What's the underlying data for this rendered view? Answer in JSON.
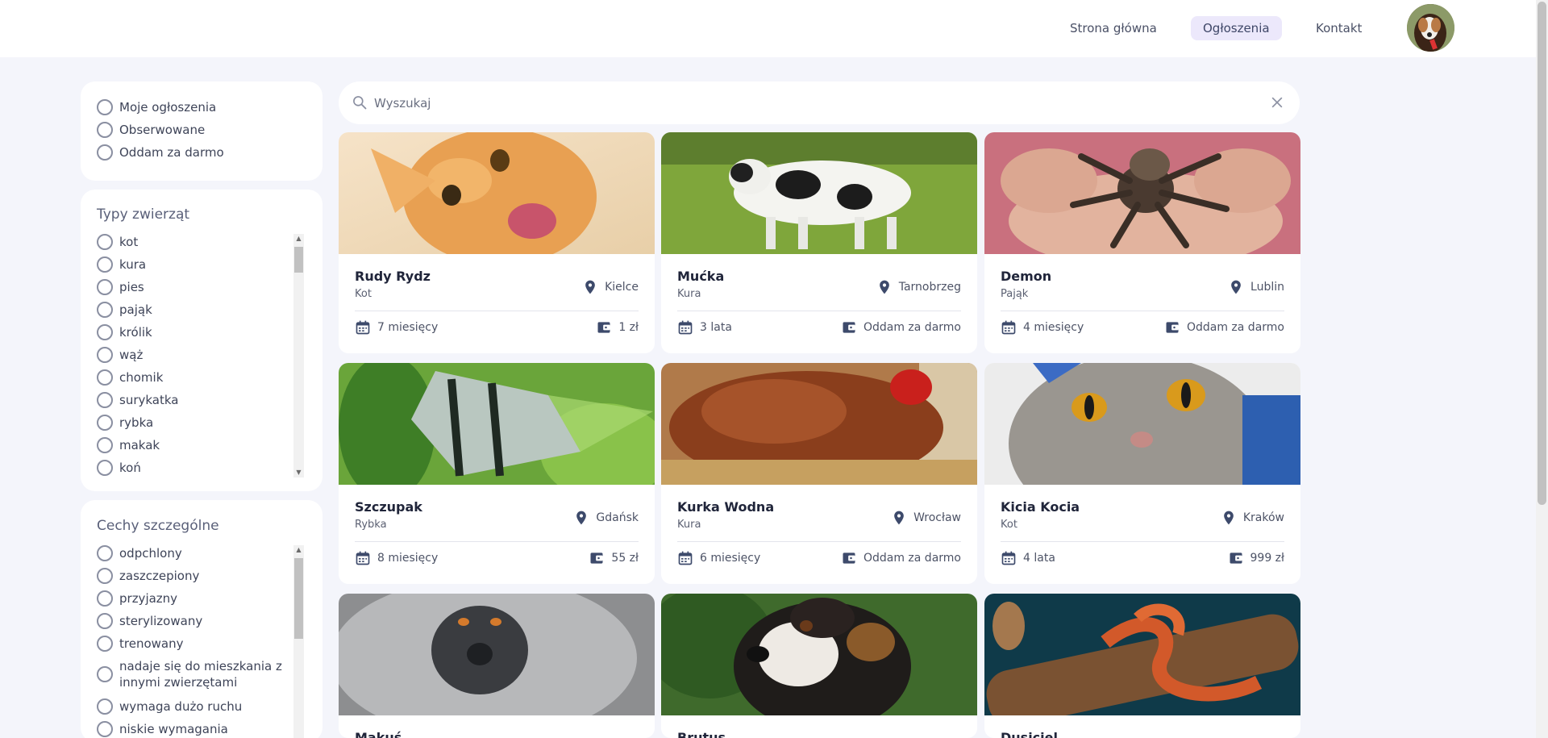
{
  "nav": {
    "links": [
      "Strona główna",
      "Ogłoszenia",
      "Kontakt"
    ],
    "active": "Ogłoszenia"
  },
  "quick_filters": [
    "Moje ogłoszenia",
    "Obserwowane",
    "Oddam za darmo"
  ],
  "animal_types": {
    "title": "Typy zwierząt",
    "items": [
      "kot",
      "kura",
      "pies",
      "pająk",
      "królik",
      "wąż",
      "chomik",
      "surykatka",
      "rybka",
      "makak",
      "koń"
    ]
  },
  "traits": {
    "title": "Cechy szczególne",
    "items": [
      "odpchlony",
      "zaszczepiony",
      "przyjazny",
      "sterylizowany",
      "trenowany",
      "nadaje się do mieszkania z innymi zwierzętami",
      "wymaga dużo ruchu",
      "niskie wymagania"
    ]
  },
  "search": {
    "placeholder": "Wyszukaj",
    "value": ""
  },
  "listings": [
    {
      "name": "Rudy Rydz",
      "type": "Kot",
      "location": "Kielce",
      "age": "7 miesięcy",
      "price": "1 zł",
      "photo": "orange-cat"
    },
    {
      "name": "Mućka",
      "type": "Kura",
      "location": "Tarnobrzeg",
      "age": "3 lata",
      "price": "Oddam za darmo",
      "photo": "cow"
    },
    {
      "name": "Demon",
      "type": "Pająk",
      "location": "Lublin",
      "age": "4 miesięcy",
      "price": "Oddam za darmo",
      "photo": "tarantula"
    },
    {
      "name": "Szczupak",
      "type": "Rybka",
      "location": "Gdańsk",
      "age": "8 miesięcy",
      "price": "55 zł",
      "photo": "angelfish"
    },
    {
      "name": "Kurka Wodna",
      "type": "Kura",
      "location": "Wrocław",
      "age": "6 miesięcy",
      "price": "Oddam za darmo",
      "photo": "hen"
    },
    {
      "name": "Kicia Kocia",
      "type": "Kot",
      "location": "Kraków",
      "age": "4 lata",
      "price": "999 zł",
      "photo": "grey-cat"
    },
    {
      "name": "Makuś",
      "type": "",
      "location": "",
      "age": "",
      "price": "",
      "photo": "langur"
    },
    {
      "name": "Brutus",
      "type": "",
      "location": "",
      "age": "",
      "price": "",
      "photo": "dog"
    },
    {
      "name": "Dusiciel",
      "type": "",
      "location": "",
      "age": "",
      "price": "",
      "photo": "corn-snake"
    }
  ],
  "colors": {
    "accent_bg": "#ece8fb",
    "icon": "#3d4a6b",
    "page_bg": "#f4f5fb"
  }
}
